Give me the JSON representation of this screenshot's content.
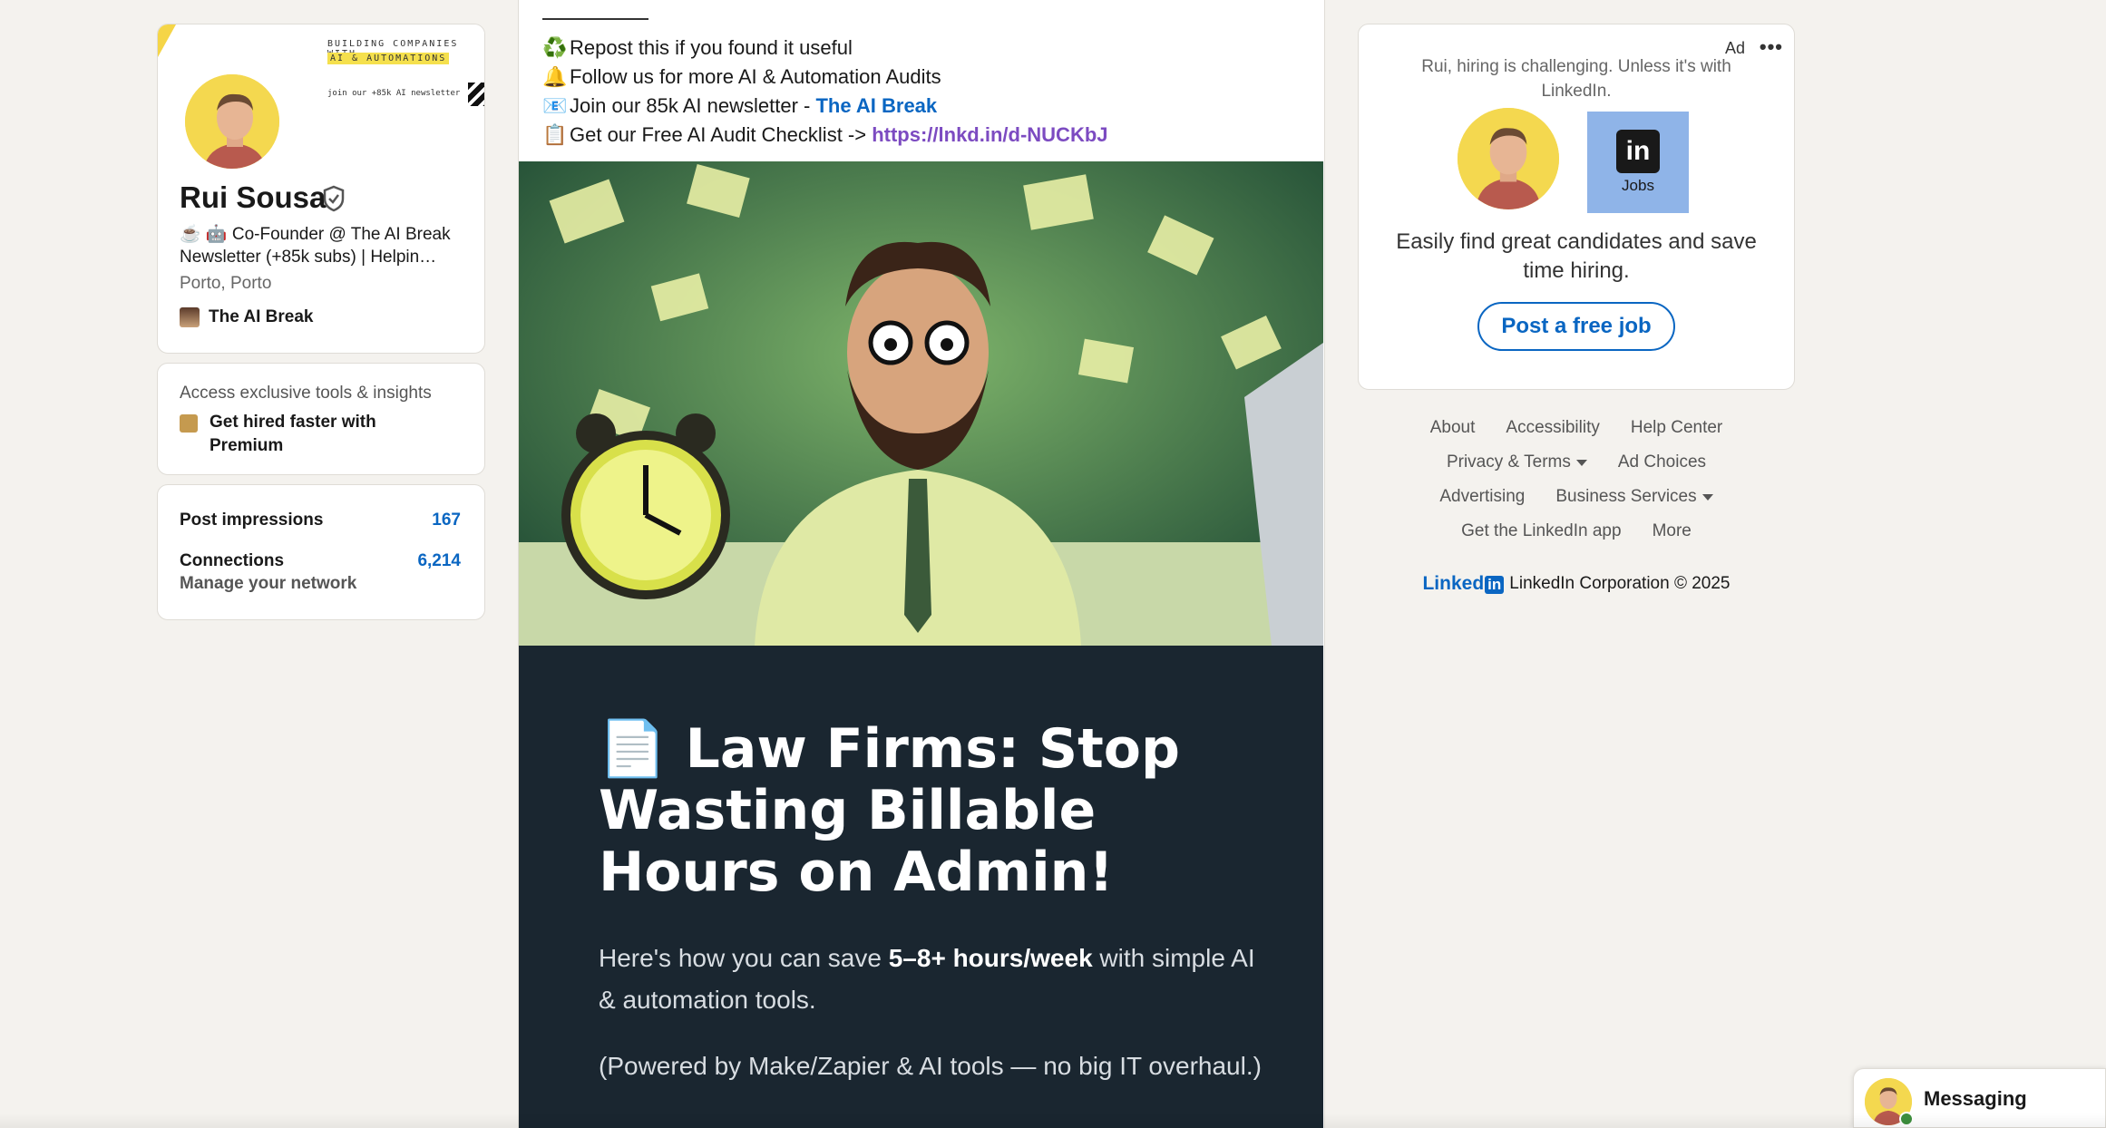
{
  "profile": {
    "banner_title": "BUILDING COMPANIES WITH",
    "banner_highlight": "AI & AUTOMATIONS",
    "banner_sub": "join our +85k AI newsletter",
    "name": "Rui Sousa",
    "headline": "☕ 🤖 Co-Founder @ The AI Break Newsletter (+85k subs) | Helpin…",
    "location": "Porto, Porto",
    "company": "The AI Break",
    "icons": [
      "verified-icon",
      "company-icon"
    ]
  },
  "premium": {
    "label": "Access exclusive tools & insights",
    "link": "Get hired faster with Premium"
  },
  "stats": {
    "impressions_label": "Post impressions",
    "impressions_value": "167",
    "connections_label": "Connections",
    "connections_value": "6,214",
    "connections_sub": "Manage your network"
  },
  "post": {
    "lines": [
      {
        "emoji": "♻️",
        "text": "Repost this if you found it useful"
      },
      {
        "emoji": "🔔",
        "text": "Follow us for more AI & Automation Audits"
      },
      {
        "emoji": "📧",
        "text": "Join our 85k AI newsletter - ",
        "link": "The AI Break"
      },
      {
        "emoji": "📋",
        "text": "Get our Free AI Audit Checklist -> ",
        "link": "https://lnkd.in/d-NUCKbJ"
      }
    ],
    "document": {
      "title": "📄 Law Firms: Stop Wasting Billable Hours on Admin!",
      "body_prefix": "Here's how you can save ",
      "body_bold": "5–8+ hours/week",
      "body_suffix": " with simple AI & automation tools.",
      "note": "(Powered by Make/Zapier & AI tools — no big IT overhaul.)"
    }
  },
  "ad": {
    "label": "Ad",
    "more": "•••",
    "tagline": "Rui, hiring is challenging. Unless it's with LinkedIn.",
    "jobs_logo_in": "in",
    "jobs_logo_text": "Jobs",
    "copy": "Easily find great candidates and save time hiring.",
    "button": "Post a free job"
  },
  "footer": {
    "row1": [
      "About",
      "Accessibility",
      "Help Center"
    ],
    "row2": [
      "Privacy & Terms",
      "Ad Choices"
    ],
    "row3": [
      "Advertising",
      "Business Services"
    ],
    "row4": [
      "Get the LinkedIn app",
      "More"
    ],
    "brand_word": "Linked",
    "brand_box": "in",
    "copyright": "LinkedIn Corporation © 2025"
  },
  "messaging": {
    "label": "Messaging"
  },
  "colors": {
    "background": "#f4f2ee",
    "link_blue": "#0a66c2",
    "link_purple": "#7c4bc1",
    "document_bg": "#1a2630",
    "avatar_bg": "#f4d84f"
  }
}
